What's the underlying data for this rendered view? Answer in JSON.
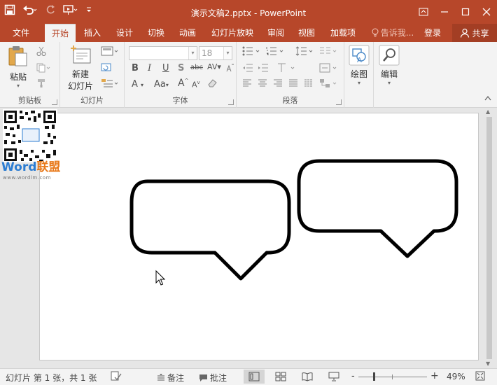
{
  "window": {
    "title": "演示文稿2.pptx - PowerPoint",
    "accent_color": "#b7472a",
    "qat": [
      {
        "name": "save-icon",
        "glyph": "🖫"
      },
      {
        "name": "undo-icon",
        "glyph": "↶"
      },
      {
        "name": "redo-icon",
        "glyph": "↻"
      },
      {
        "name": "start-from-beginning-icon",
        "glyph": "⊡"
      },
      {
        "name": "customize-qat-icon",
        "glyph": "⌄"
      }
    ],
    "controls": {
      "ribbon_display": "⊡",
      "minimize": "—",
      "maximize": "☐",
      "close": "✕"
    }
  },
  "tabs": [
    {
      "id": "file",
      "label": "文件"
    },
    {
      "id": "home",
      "label": "开始",
      "active": true
    },
    {
      "id": "insert",
      "label": "插入"
    },
    {
      "id": "design",
      "label": "设计"
    },
    {
      "id": "transitions",
      "label": "切换"
    },
    {
      "id": "animations",
      "label": "动画"
    },
    {
      "id": "slideshow",
      "label": "幻灯片放映"
    },
    {
      "id": "review",
      "label": "审阅"
    },
    {
      "id": "view",
      "label": "视图"
    },
    {
      "id": "addins",
      "label": "加载项"
    },
    {
      "id": "tellme",
      "label": "告诉我..."
    },
    {
      "id": "signin",
      "label": "登录"
    }
  ],
  "share": {
    "label": "共享"
  },
  "ribbon": {
    "clipboard": {
      "label": "剪贴板",
      "paste": "粘贴"
    },
    "slides": {
      "label": "幻灯片",
      "new_slide_line1": "新建",
      "new_slide_line2": "幻灯片"
    },
    "font": {
      "label": "字体",
      "font_name": "",
      "font_size": "18"
    },
    "paragraph": {
      "label": "段落"
    },
    "drawing": {
      "label": "绘图"
    },
    "editing": {
      "label": "编辑"
    }
  },
  "watermark": {
    "word": "Word",
    "cn": "联盟",
    "url": "www.wordlm.com"
  },
  "status": {
    "slide_info": "幻灯片 第 1 张，共 1 张",
    "notes": "备注",
    "comments": "批注",
    "zoom": "49%",
    "zoom_minus": "-",
    "zoom_plus": "+"
  }
}
